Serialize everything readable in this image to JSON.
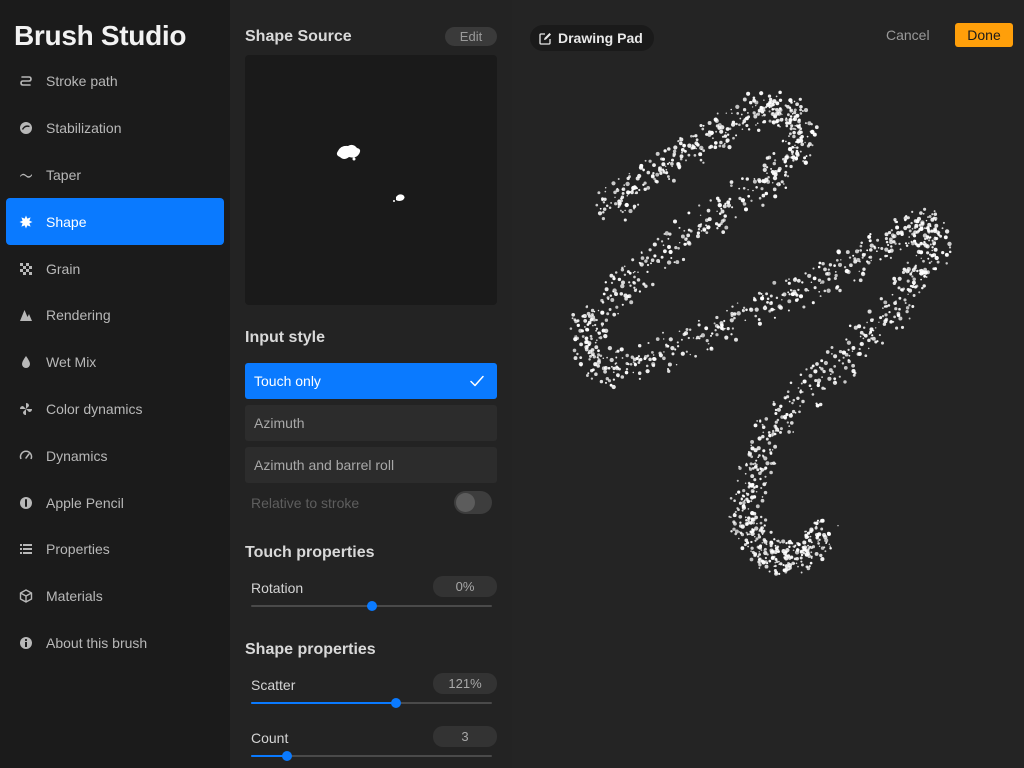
{
  "app_title": "Brush Studio",
  "sidebar": {
    "items": [
      {
        "label": "Stroke path",
        "icon": "stroke-path-icon",
        "active": false
      },
      {
        "label": "Stabilization",
        "icon": "stabilization-icon",
        "active": false
      },
      {
        "label": "Taper",
        "icon": "taper-icon",
        "active": false
      },
      {
        "label": "Shape",
        "icon": "shape-icon",
        "active": true
      },
      {
        "label": "Grain",
        "icon": "grain-icon",
        "active": false
      },
      {
        "label": "Rendering",
        "icon": "rendering-icon",
        "active": false
      },
      {
        "label": "Wet Mix",
        "icon": "wet-mix-icon",
        "active": false
      },
      {
        "label": "Color dynamics",
        "icon": "color-dynamics-icon",
        "active": false
      },
      {
        "label": "Dynamics",
        "icon": "dynamics-icon",
        "active": false
      },
      {
        "label": "Apple Pencil",
        "icon": "apple-pencil-icon",
        "active": false
      },
      {
        "label": "Properties",
        "icon": "properties-icon",
        "active": false
      },
      {
        "label": "Materials",
        "icon": "materials-icon",
        "active": false
      },
      {
        "label": "About this brush",
        "icon": "about-icon",
        "active": false
      }
    ]
  },
  "panel": {
    "shape_source": {
      "title": "Shape Source",
      "edit_label": "Edit"
    },
    "input_style": {
      "title": "Input style",
      "options": [
        {
          "label": "Touch only",
          "selected": true
        },
        {
          "label": "Azimuth",
          "selected": false
        },
        {
          "label": "Azimuth and barrel roll",
          "selected": false
        }
      ],
      "relative_label": "Relative to stroke",
      "relative_enabled": false
    },
    "touch_properties": {
      "title": "Touch properties",
      "rotation": {
        "label": "Rotation",
        "value": "0%",
        "level": 0.5
      }
    },
    "shape_properties": {
      "title": "Shape properties",
      "scatter": {
        "label": "Scatter",
        "value": "121%",
        "level": 0.6
      },
      "count": {
        "label": "Count",
        "value": "3",
        "level": 0.15
      }
    }
  },
  "pad": {
    "badge": "Drawing Pad",
    "badge_icon": "edit-icon",
    "cancel_label": "Cancel",
    "done_label": "Done"
  },
  "colors": {
    "accent": "#0a7aff",
    "done": "#ff9f0a"
  }
}
